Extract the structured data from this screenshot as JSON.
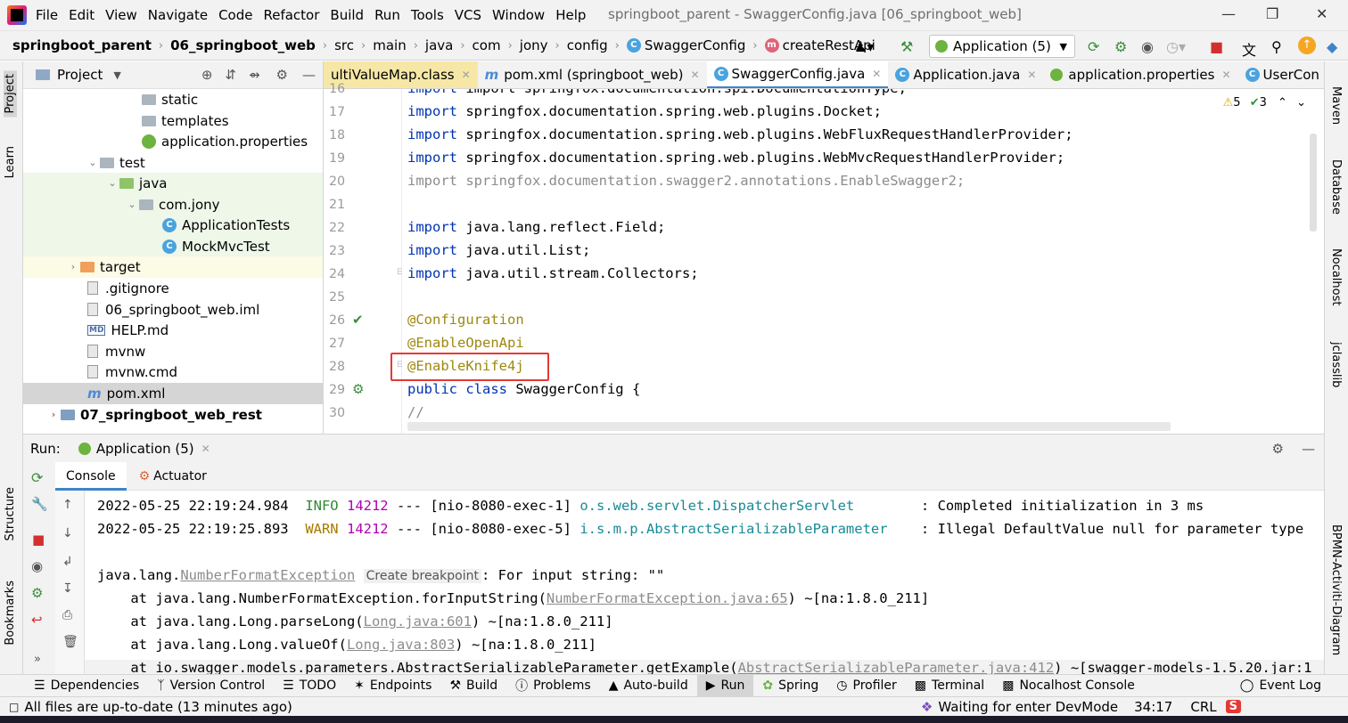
{
  "menubar": {
    "items": [
      "File",
      "Edit",
      "View",
      "Navigate",
      "Code",
      "Refactor",
      "Build",
      "Run",
      "Tools",
      "VCS",
      "Window",
      "Help"
    ],
    "window_title": "springboot_parent - SwaggerConfig.java [06_springboot_web]"
  },
  "navbar": {
    "crumbs": [
      "springboot_parent",
      "06_springboot_web",
      "src",
      "main",
      "java",
      "com",
      "jony",
      "config",
      "SwaggerConfig",
      "createRestApi"
    ],
    "run_config": "Application (5)"
  },
  "project": {
    "title": "Project",
    "tree": [
      {
        "label": "static",
        "indent": 0,
        "kind": "folder"
      },
      {
        "label": "templates",
        "indent": 0,
        "kind": "folder"
      },
      {
        "label": "application.properties",
        "indent": 0,
        "kind": "spring"
      },
      {
        "label": "test",
        "indent": 0,
        "kind": "folder"
      },
      {
        "label": "java",
        "indent": 0,
        "kind": "folder-green"
      },
      {
        "label": "com.jony",
        "indent": 0,
        "kind": "package"
      },
      {
        "label": "ApplicationTests",
        "indent": 0,
        "kind": "class"
      },
      {
        "label": "MockMvcTest",
        "indent": 0,
        "kind": "class"
      },
      {
        "label": "target",
        "indent": 0,
        "kind": "folder-orange"
      },
      {
        "label": ".gitignore",
        "indent": 0,
        "kind": "file"
      },
      {
        "label": "06_springboot_web.iml",
        "indent": 0,
        "kind": "file"
      },
      {
        "label": "HELP.md",
        "indent": 0,
        "kind": "md"
      },
      {
        "label": "mvnw",
        "indent": 0,
        "kind": "file"
      },
      {
        "label": "mvnw.cmd",
        "indent": 0,
        "kind": "file"
      },
      {
        "label": "pom.xml",
        "indent": 0,
        "kind": "maven"
      },
      {
        "label": "07_springboot_web_rest",
        "indent": 0,
        "kind": "module"
      }
    ]
  },
  "editor": {
    "tabs": [
      "ultiValueMap.class",
      "pom.xml (springboot_web)",
      "SwaggerConfig.java",
      "Application.java",
      "application.properties",
      "UserCon"
    ],
    "active_tab": "SwaggerConfig.java",
    "warnings": "5",
    "weak_warnings": "3",
    "line_numbers": [
      "16",
      "17",
      "18",
      "19",
      "20",
      "21",
      "22",
      "23",
      "24",
      "25",
      "26",
      "27",
      "28",
      "29",
      "30"
    ],
    "lines": [
      "import springfox.documentation.spi.DocumentationType;",
      "import springfox.documentation.spring.web.plugins.Docket;",
      "import springfox.documentation.spring.web.plugins.WebFluxRequestHandlerProvider;",
      "import springfox.documentation.spring.web.plugins.WebMvcRequestHandlerProvider;",
      "import springfox.documentation.swagger2.annotations.EnableSwagger2;",
      "",
      "import java.lang.reflect.Field;",
      "import java.util.List;",
      "import java.util.stream.Collectors;",
      "",
      "@Configuration",
      "@EnableOpenApi",
      "@EnableKnife4j",
      "public class SwaggerConfig {",
      "//"
    ]
  },
  "run_panel": {
    "label": "Run:",
    "config_tab": "Application (5)",
    "subtabs": [
      "Console",
      "Actuator"
    ],
    "console": {
      "l1_time": "2022-05-25 22:19:24.984",
      "l1_level": "INFO",
      "l1_pid": "14212",
      "l1_thread": "--- [nio-8080-exec-1]",
      "l1_logger": "o.s.web.servlet.DispatcherServlet",
      "l1_msg": ": Completed initialization in 3 ms",
      "l2_time": "2022-05-25 22:19:25.893",
      "l2_level": "WARN",
      "l2_pid": "14212",
      "l2_thread": "--- [nio-8080-exec-5]",
      "l2_logger": "i.s.m.p.AbstractSerializableParameter",
      "l2_msg": ": Illegal DefaultValue null for parameter type",
      "ex_prefix": "java.lang.",
      "ex_class": "NumberFormatException",
      "ex_bp": "Create breakpoint",
      "ex_msg": ": For input string: \"\"",
      "st1_a": "at java.lang.NumberFormatException.forInputString(",
      "st1_link": "NumberFormatException.java:65",
      "st1_b": ") ~[na:1.8.0_211]",
      "st2_a": "at java.lang.Long.parseLong(",
      "st2_link": "Long.java:601",
      "st2_b": ") ~[na:1.8.0_211]",
      "st3_a": "at java.lang.Long.valueOf(",
      "st3_link": "Long.java:803",
      "st3_b": ") ~[na:1.8.0_211]",
      "st4_a": "at io.swagger.models.parameters.AbstractSerializableParameter.getExample(",
      "st4_link": "AbstractSerializableParameter.java:412",
      "st4_b": ") ~[swagger-models-1.5.20.jar:1"
    }
  },
  "side_tabs": {
    "left_top": [
      "Project",
      "Learn"
    ],
    "left_bottom": [
      "Structure",
      "Bookmarks"
    ],
    "right": [
      "Maven",
      "Database",
      "Nocalhost",
      "jclasslib",
      "BPMN-Activiti-Diagram"
    ]
  },
  "tool_windows": [
    "Dependencies",
    "Version Control",
    "TODO",
    "Endpoints",
    "Build",
    "Problems",
    "Auto-build",
    "Run",
    "Spring",
    "Profiler",
    "Terminal",
    "Nocalhost Console",
    "Event Log"
  ],
  "status": {
    "message": "All files are up-to-date (13 minutes ago)",
    "devmode": "Waiting for enter DevMode",
    "position": "34:17",
    "line_sep": "CRL"
  },
  "colors": {
    "keyword": "#0033b3",
    "annotation": "#9e880d",
    "highlight_box": "#e53935",
    "info": "#2f8a33",
    "warn": "#a77a00",
    "accent": "#4083c9"
  }
}
